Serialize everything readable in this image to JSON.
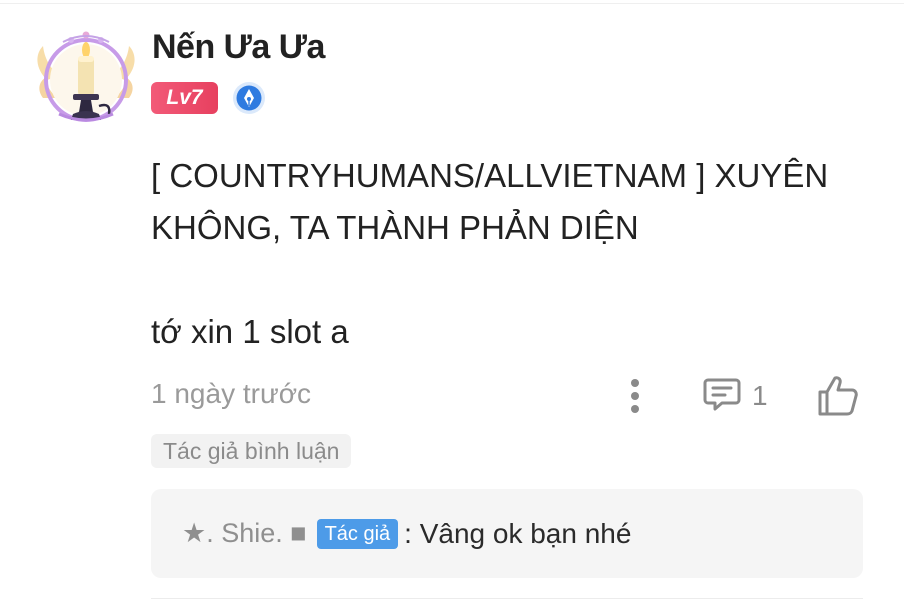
{
  "comment": {
    "username": "Nến Ưa Ưa",
    "level": "Lv7",
    "text": "[ COUNTRYHUMANS/ALLVIETNAM ] XUYÊN KHÔNG, TA THÀNH PHẢN DIỆN\n\ntớ xin 1 slot a",
    "timestamp": "1 ngày trước",
    "reply_count": "1",
    "author_commented_tag": "Tác giả bình luận"
  },
  "reply": {
    "author": "★. Shie. ■",
    "author_badge": "Tác giả",
    "text": ": Vâng ok bạn nhé"
  },
  "icons": {
    "avatar": "candle-avatar",
    "medal": "pen-medal-icon",
    "more": "more-vertical-icon",
    "reply": "comment-icon",
    "like": "thumbs-up-icon"
  },
  "colors": {
    "level_badge": "#e7405f",
    "author_badge": "#4d9be8",
    "medal": "#2f7be0"
  }
}
